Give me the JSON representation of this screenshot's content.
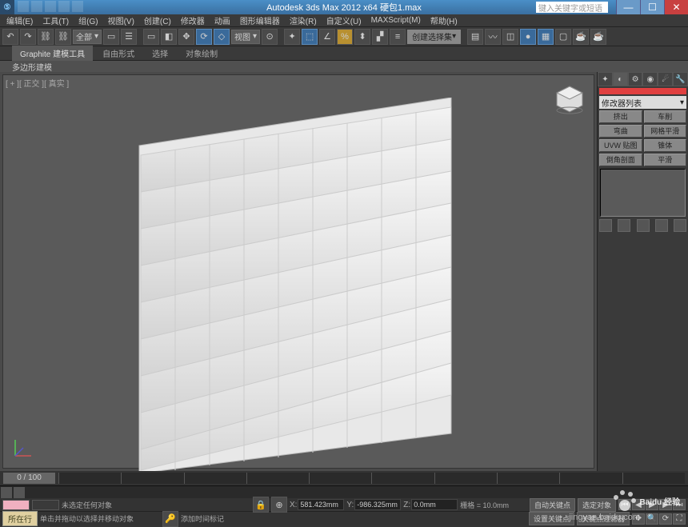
{
  "title": "Autodesk 3ds Max 2012 x64   硬包1.max",
  "search_placeholder": "键入关键字或短语",
  "menus": [
    "编辑(E)",
    "工具(T)",
    "组(G)",
    "视图(V)",
    "创建(C)",
    "修改器",
    "动画",
    "图形编辑器",
    "渲染(R)",
    "自定义(U)",
    "MAXScript(M)",
    "帮助(H)"
  ],
  "toolbar": {
    "selection_filter": "全部",
    "view_label": "视图",
    "create_selection": "创建选择集"
  },
  "ribbon": {
    "tabs": [
      "Graphite 建模工具",
      "自由形式",
      "选择",
      "对象绘制"
    ],
    "sub": "多边形建模"
  },
  "viewport_label": "[ + ][ 正交 ][ 真实 ]",
  "command_panel": {
    "modifier_list": "修改器列表",
    "buttons_row1": [
      "挤出",
      "车削"
    ],
    "buttons_row2": [
      "弯曲",
      "网格平滑"
    ],
    "buttons_row3": [
      "UVW 贴图",
      "锥体"
    ],
    "buttons_row4": [
      "倒角剖面",
      "平滑"
    ]
  },
  "timeline": {
    "current": "0 / 100"
  },
  "status": {
    "location": "所在行",
    "no_selection": "未选定任何对象",
    "hint": "单击并拖动以选择并移动对象",
    "add_time_tag": "添加时间标记",
    "x": "581.423mm",
    "y": "-986.325mm",
    "z": "0.0mm",
    "grid": "栅格 = 10.0mm",
    "auto_key": "自动关键点",
    "sel_key": "选定对象",
    "set_key": "设置关键点",
    "key_filter": "关键点过滤器"
  },
  "watermark": {
    "brand": "Baidu",
    "suffix": "经验",
    "url": "jingyan.baidu.com"
  }
}
